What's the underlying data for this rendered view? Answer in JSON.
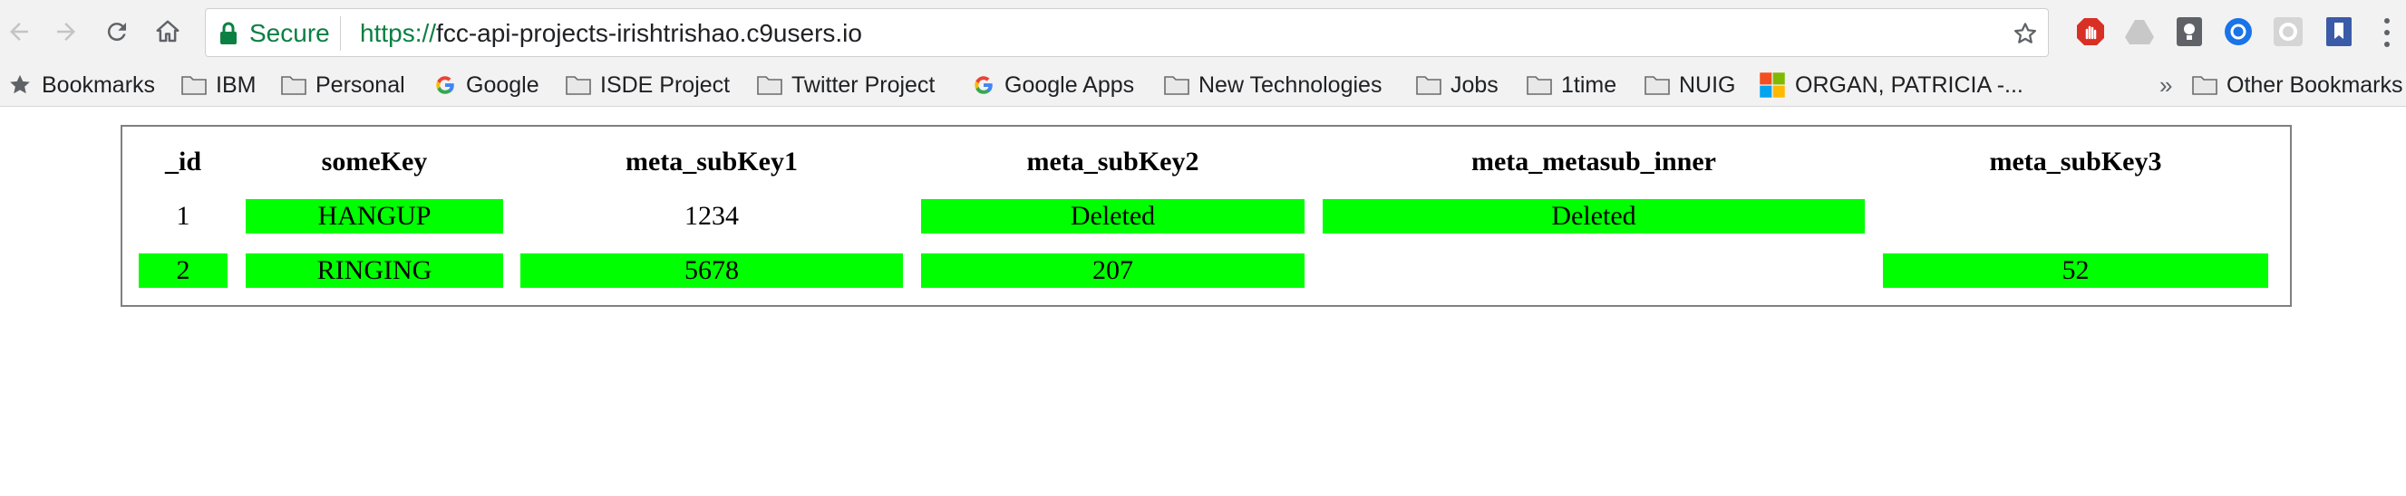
{
  "browser": {
    "secure_label": "Secure",
    "url_scheme": "https://",
    "url_host": "fcc-api-projects-irishtrishao.c9users.io"
  },
  "bookmarks": {
    "items": [
      "Bookmarks",
      "IBM",
      "Personal",
      "Google",
      "ISDE Project",
      "Twitter Project",
      "Google Apps",
      "New Technologies",
      "Jobs",
      "1time",
      "NUIG",
      "ORGAN, PATRICIA -..."
    ],
    "overflow": "»",
    "other": "Other Bookmarks"
  },
  "table": {
    "headers": [
      "_id",
      "someKey",
      "meta_subKey1",
      "meta_subKey2",
      "meta_metasub_inner",
      "meta_subKey3"
    ],
    "rows": [
      [
        "1",
        "HANGUP",
        "1234",
        "Deleted",
        "Deleted",
        ""
      ],
      [
        "2",
        "RINGING",
        "5678",
        "207",
        "",
        "52"
      ]
    ]
  },
  "colors": {
    "highlight": "#00ff00",
    "secure_green": "#0b8043",
    "frame_border": "#808080"
  }
}
